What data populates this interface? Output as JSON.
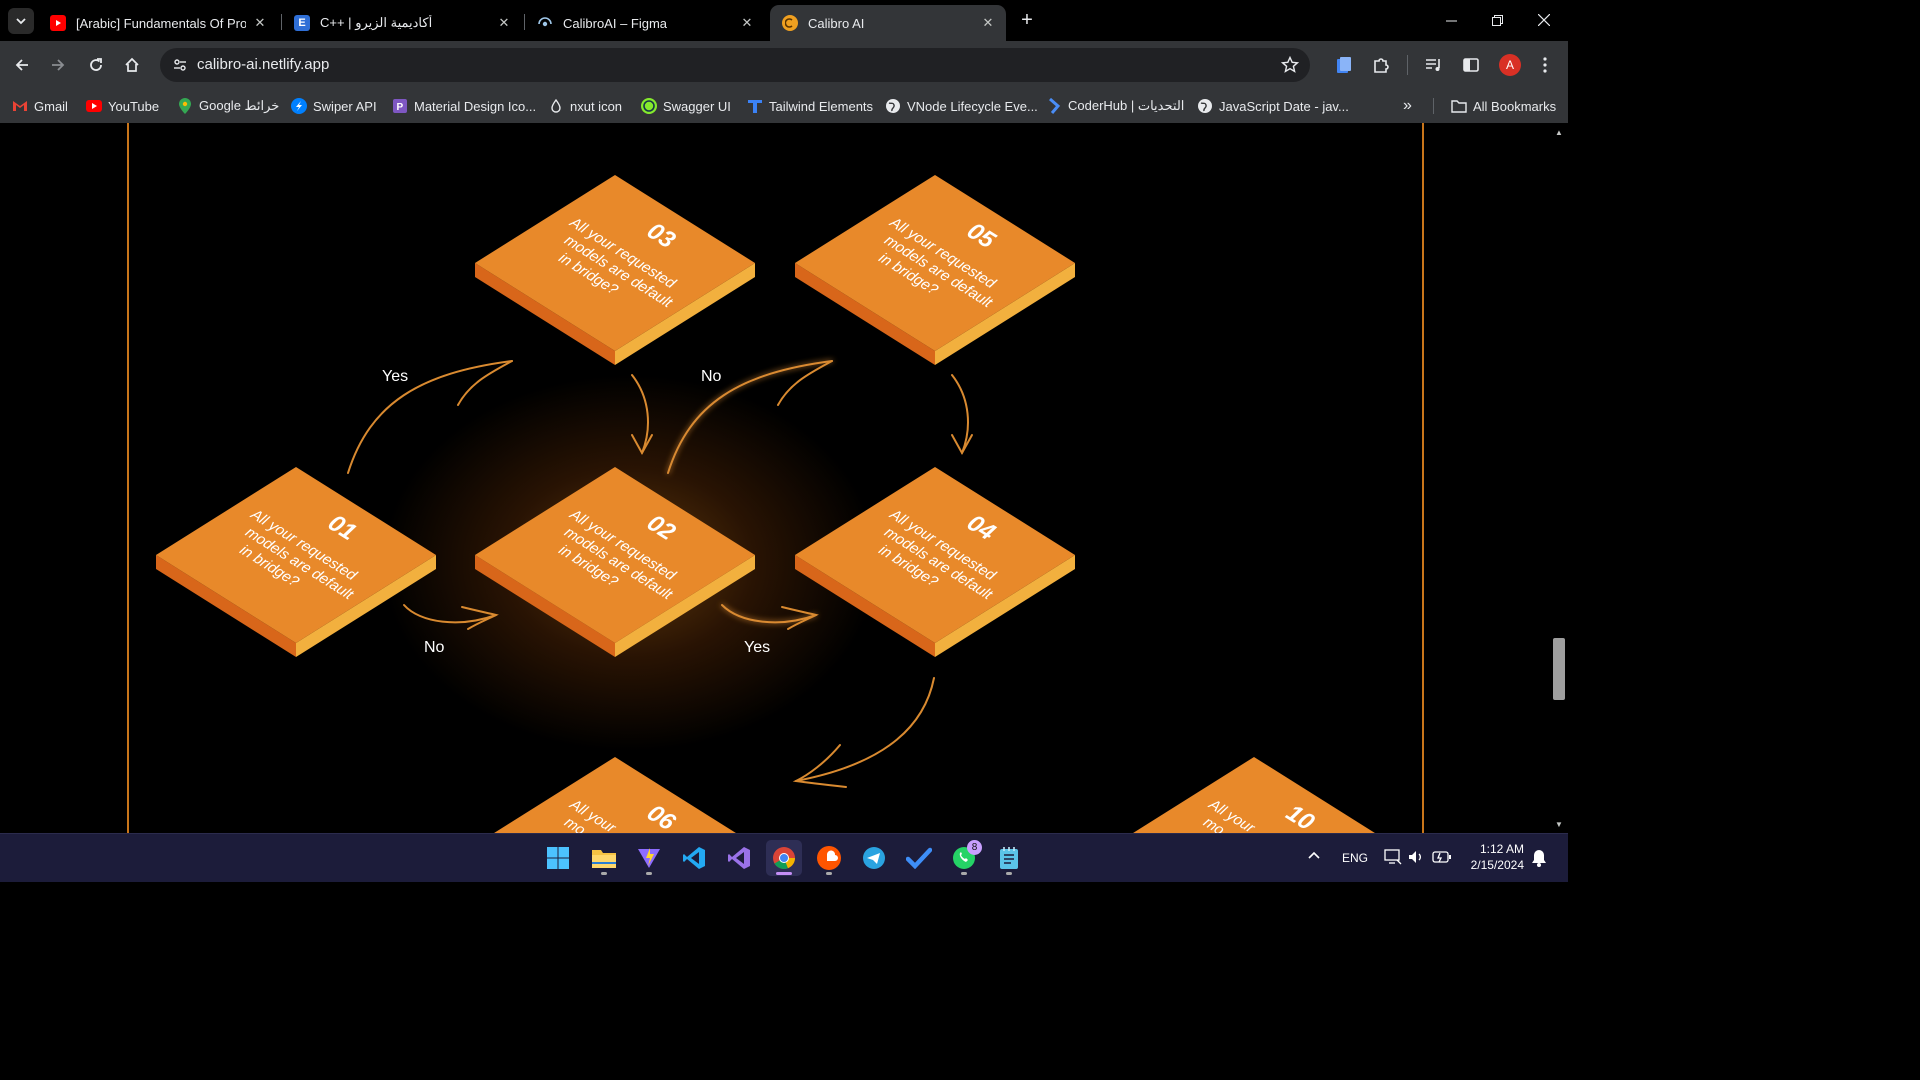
{
  "tabs": [
    {
      "title": "[Arabic] Fundamentals Of Programming",
      "icon": "youtube-icon"
    },
    {
      "title": "C++ | أكاديمية الزيرو",
      "icon": "e-icon"
    },
    {
      "title": "CalibroAI – Figma",
      "icon": "figma-icon"
    },
    {
      "title": "Calibro AI",
      "icon": "calibro-icon",
      "active": true
    }
  ],
  "address": {
    "url": "calibro-ai.netlify.app"
  },
  "bookmarks": [
    {
      "label": "Gmail",
      "icon": "gmail-icon"
    },
    {
      "label": "YouTube",
      "icon": "youtube-icon"
    },
    {
      "label": "Google خرائط",
      "icon": "maps-icon"
    },
    {
      "label": "Swiper API",
      "icon": "swiper-icon"
    },
    {
      "label": "Material Design Ico...",
      "icon": "material-icon"
    },
    {
      "label": "nxut icon",
      "icon": "nuxt-icon"
    },
    {
      "label": "Swagger UI",
      "icon": "swagger-icon"
    },
    {
      "label": "Tailwind Elements",
      "icon": "tailwind-icon"
    },
    {
      "label": "VNode Lifecycle Eve...",
      "icon": "globe-icon"
    },
    {
      "label": "CoderHub | التحديات",
      "icon": "coderhub-icon"
    },
    {
      "label": "JavaScript Date - jav...",
      "icon": "globe-icon"
    }
  ],
  "all_bookmarks": "All Bookmarks",
  "flow": {
    "tiles": [
      {
        "num": "01",
        "text_lines": [
          "All your requested",
          "models are default",
          "in bridge?"
        ]
      },
      {
        "num": "02",
        "text_lines": [
          "All your requested",
          "models are default",
          "in bridge?"
        ]
      },
      {
        "num": "03",
        "text_lines": [
          "All your requested",
          "models are default",
          "in bridge?"
        ]
      },
      {
        "num": "04",
        "text_lines": [
          "All your requested",
          "models are default",
          "in bridge?"
        ]
      },
      {
        "num": "05",
        "text_lines": [
          "All your requested",
          "models are default",
          "in bridge?"
        ]
      },
      {
        "num": "06",
        "text_lines": [
          "All your",
          "mo..."
        ]
      },
      {
        "num": "10",
        "text_lines": [
          "All your",
          "mo..."
        ]
      }
    ],
    "labels": {
      "yes_top": "Yes",
      "no_top": "No",
      "no_bottom": "No",
      "yes_bottom": "Yes"
    },
    "colors": {
      "tile_top": "#e8892a",
      "tile_left": "#d8661a",
      "tile_right": "#f2b03e",
      "accent": "#c9751a"
    }
  },
  "taskbar": {
    "apps": [
      "start-icon",
      "file-explorer-icon",
      "vite-icon",
      "vscode-icon",
      "visual-studio-icon",
      "chrome-icon",
      "soundcloud-icon",
      "telegram-icon",
      "todo-icon",
      "whatsapp-icon",
      "notepad-icon"
    ],
    "whatsapp_badge": "8",
    "lang": "ENG",
    "time": "1:12 AM",
    "date": "2/15/2024"
  }
}
